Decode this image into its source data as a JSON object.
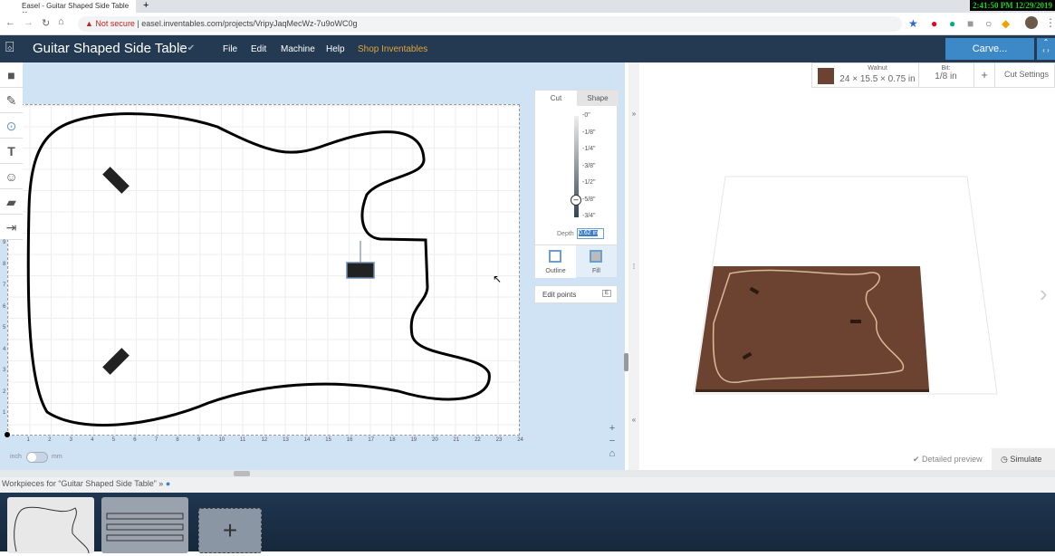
{
  "browser": {
    "tab_title": "Easel - Guitar Shaped Side Table",
    "security": "Not secure",
    "url": "easel.inventables.com/projects/VripyJaqMecWz-7u9oWC0g",
    "clock": "2:41:50 PM 12/29/2019"
  },
  "app": {
    "title": "Guitar Shaped Side Table",
    "menu": [
      "File",
      "Edit",
      "Machine",
      "Help",
      "Shop Inventables"
    ],
    "carve_label": "Carve...",
    "accent": "#3d89c8",
    "header_bg": "#233a52"
  },
  "canvas": {
    "x_ticks": [
      "1",
      "2",
      "3",
      "4",
      "5",
      "6",
      "7",
      "8",
      "9",
      "10",
      "11",
      "12",
      "13",
      "14",
      "15",
      "16",
      "17",
      "18",
      "19",
      "20",
      "21",
      "22",
      "23",
      "24"
    ],
    "y_ticks": [
      "1",
      "2",
      "3",
      "4",
      "5",
      "6",
      "7",
      "8",
      "9"
    ],
    "unit_left": "inch",
    "unit_right": "mm"
  },
  "cut_panel": {
    "tabs": [
      "Cut",
      "Shape"
    ],
    "depth_marks": [
      "-0\"",
      "-1/8\"",
      "-1/4\"",
      "-3/8\"",
      "-1/2\"",
      "-5/8\"",
      "-3/4\""
    ],
    "depth_label": "Depth",
    "depth_value": "0.62 in",
    "depth_fraction": 0.83,
    "outline_label": "Outline",
    "fill_label": "Fill",
    "edit_points": "Edit points",
    "edit_key": "E"
  },
  "material": {
    "name": "Walnut",
    "dims": "24 × 15.5 × 0.75 in",
    "bit_label": "Bit:",
    "bit_value": "1/8 in",
    "add": "+",
    "cut_settings": "Cut Settings",
    "color": "#6b4330"
  },
  "preview": {
    "detailed": "Detailed preview",
    "simulate": "Simulate"
  },
  "workpieces": {
    "label": "Workpieces for “Guitar Shaped Side Table”",
    "add": "+"
  }
}
